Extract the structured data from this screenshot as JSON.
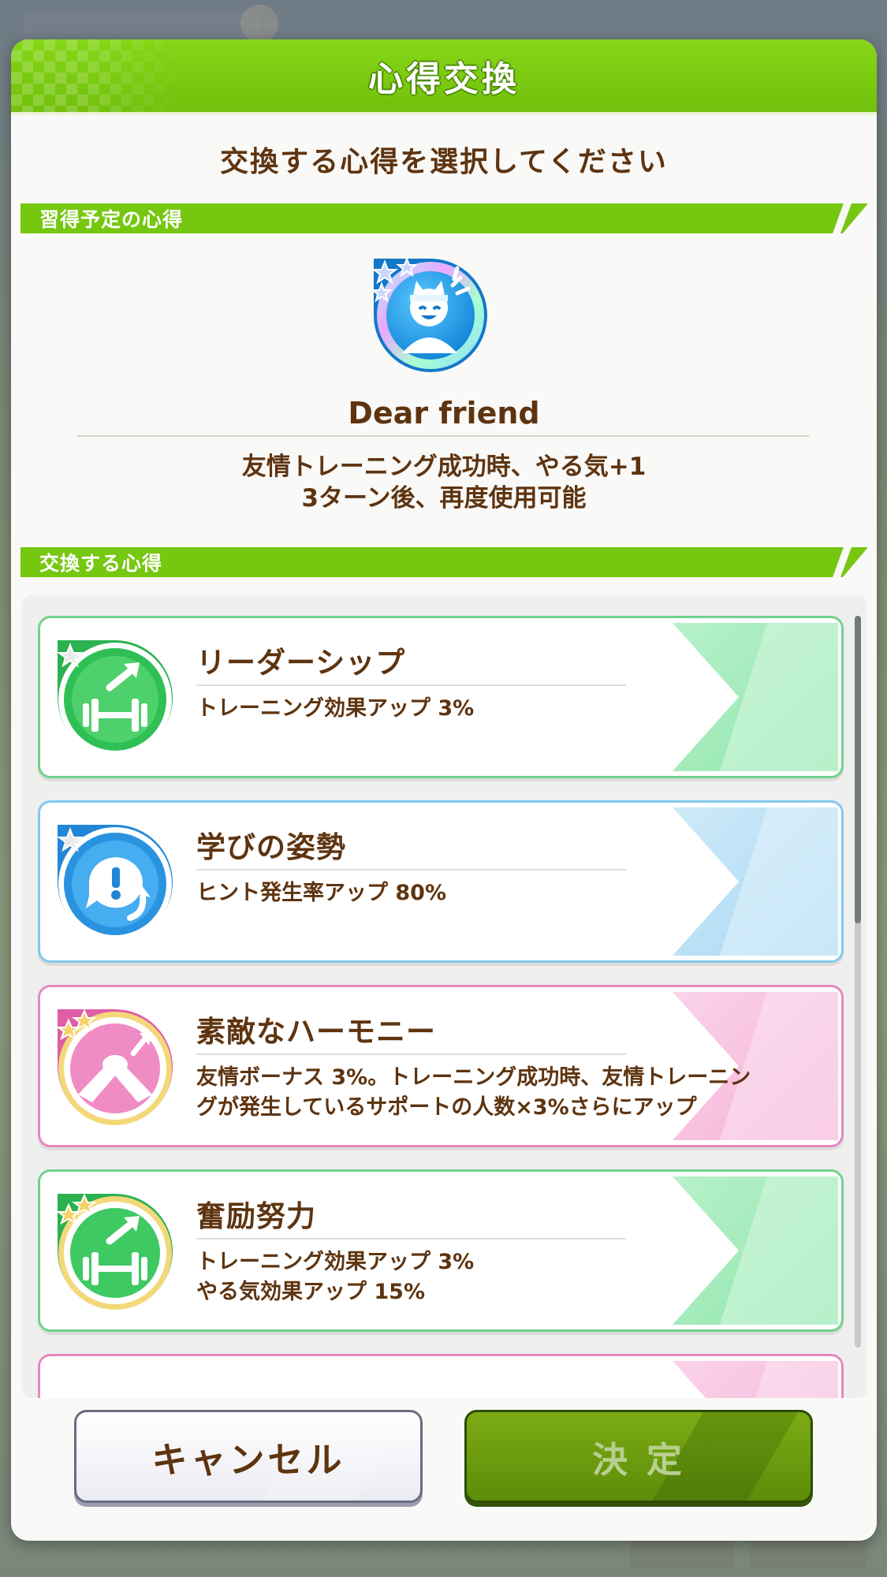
{
  "dialog": {
    "title": "心得交換",
    "instruction": "交換する心得を選択してください",
    "planned_section_label": "習得予定の心得",
    "exchange_section_label": "交換する心得"
  },
  "planned_skill": {
    "name": "Dear friend",
    "desc_line1": "友情トレーニング成功時、やる気+1",
    "desc_line2": "3ターン後、再度使用可能",
    "icon": "friend-face-icon"
  },
  "skills": [
    {
      "name": "リーダーシップ",
      "desc_line1": "トレーニング効果アップ 3%",
      "desc_line2": "",
      "color": "#36c15f",
      "icon": "dumbbell-up-icon",
      "stars": 1
    },
    {
      "name": "学びの姿勢",
      "desc_line1": "ヒント発生率アップ 80%",
      "desc_line2": "",
      "color": "#2b97dd",
      "icon": "hint-exclaim-icon",
      "stars": 1
    },
    {
      "name": "素敵なハーモニー",
      "desc_line1": "友情ボーナス 3%。トレーニング成功時、友情トレーニン",
      "desc_line2": "グが発生しているサポートの人数×3%さらにアップ",
      "color": "#e472b1",
      "icon": "handshake-icon",
      "stars": 2
    },
    {
      "name": "奮励努力",
      "desc_line1": "トレーニング効果アップ 3%",
      "desc_line2": "やる気効果アップ 15%",
      "color": "#36c15f",
      "icon": "dumbbell-up-icon",
      "stars": 2
    }
  ],
  "buttons": {
    "cancel": "キャンセル",
    "confirm": "決 定"
  }
}
